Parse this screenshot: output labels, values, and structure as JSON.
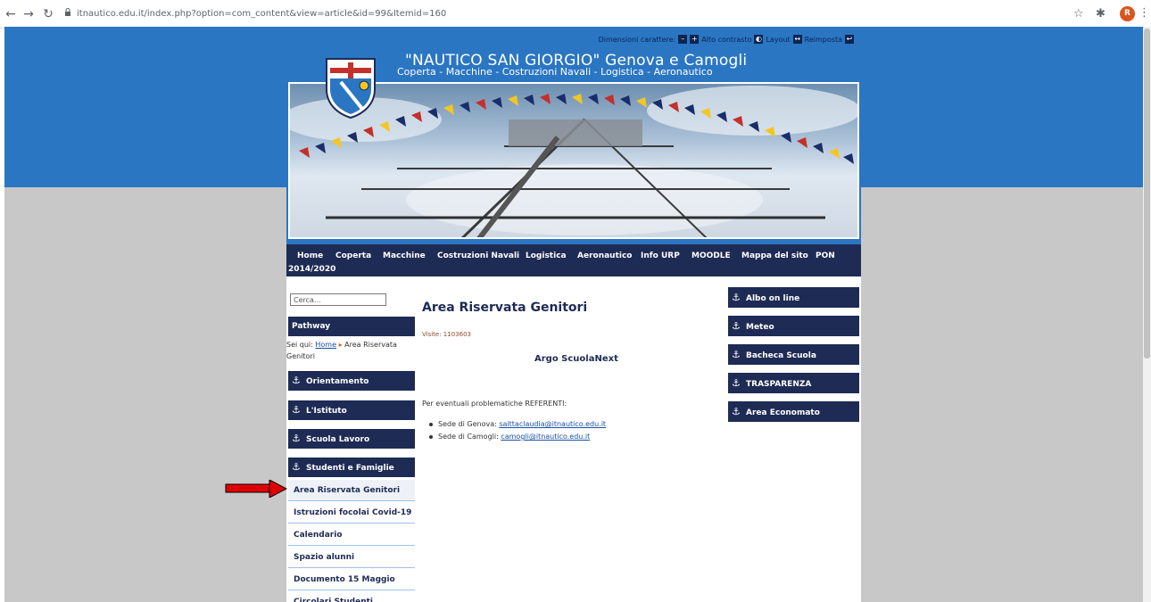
{
  "browser": {
    "url": "itnautico.edu.it/index.php?option=com_content&view=article&id=99&Itemid=160",
    "profile_initial": "R"
  },
  "tools": {
    "dimensioni_label": "Dimensioni carattere:",
    "contrast_label": "Alto contrasto",
    "layout_label": "Layout",
    "reset_label": "Reimposta"
  },
  "site": {
    "title": "\"NAUTICO SAN GIORGIO\" Genova e Camogli",
    "subtitle": "Coperta - Macchine - Costruzioni Navali - Logistica - Aeronautico"
  },
  "mainnav": {
    "items": [
      "Home",
      "Coperta",
      "Macchine",
      "Costruzioni Navali",
      "Logistica",
      "Aeronautico",
      "Info URP",
      "MOODLE",
      "Mappa del sito",
      "PON",
      "2014/2020"
    ]
  },
  "left": {
    "search_placeholder": "Cerca...",
    "pathway_title": "Pathway",
    "crumbs_prefix": "Sei qui:",
    "crumbs_home": "Home",
    "crumbs_current": "Area Riservata Genitori",
    "sections": [
      "Orientamento",
      "L'Istituto",
      "Scuola Lavoro",
      "Studenti e Famiglie"
    ],
    "subitems": [
      "Area Riservata Genitori",
      "Istruzioni focolai Covid-19",
      "Calendario",
      "Spazio alunni",
      "Documento 15 Maggio",
      "Circolari Studenti"
    ]
  },
  "content": {
    "title": "Area Riservata Genitori",
    "visits": "Visite: 1103603",
    "argo": "Argo ScuolaNext",
    "referenti": "Per eventuali problematiche REFERENTI:",
    "list": [
      {
        "label": "Sede di Genova:",
        "email": "saittaclaudia@itnautico.edu.it"
      },
      {
        "label": "Sede di Camogli:",
        "email": "camogli@itnautico.edu.it"
      }
    ]
  },
  "right": {
    "items": [
      "Albo on line",
      "Meteo",
      "Bacheca Scuola",
      "TRASPARENZA",
      "Area Economato"
    ]
  },
  "colors": {
    "brand_blue": "#2a76c3",
    "navy": "#1e2b55",
    "annotation_red": "#e00000"
  }
}
